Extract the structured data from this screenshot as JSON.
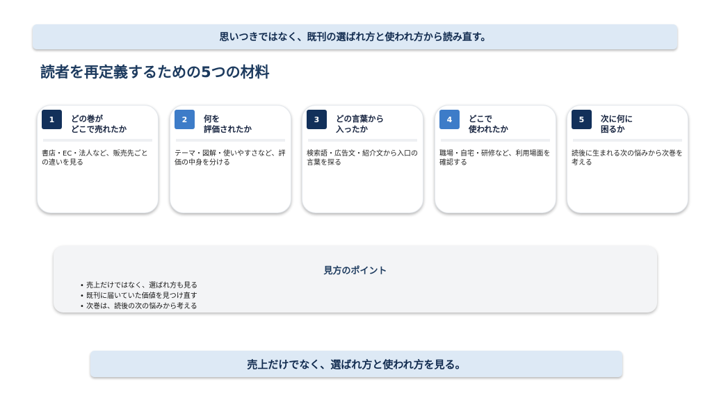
{
  "top_banner": "思いつきではなく、既刊の選ばれ方と使われ方から読み直す。",
  "title": "読者を再定義するための5つの材料",
  "cards": [
    {
      "num": "1",
      "heading": "どの巻が\nどこで売れたか",
      "body": "書店・EC・法人など、販売先ごとの違いを見る",
      "color": "#12305a"
    },
    {
      "num": "2",
      "heading": "何を\n評価されたか",
      "body": "テーマ・図解・使いやすさなど、評価の中身を分ける",
      "color": "#3d7cc8"
    },
    {
      "num": "3",
      "heading": "どの言葉から\n入ったか",
      "body": "検索語・広告文・紹介文から入口の言葉を探る",
      "color": "#12305a"
    },
    {
      "num": "4",
      "heading": "どこで\n使われたか",
      "body": "職場・自宅・研修など、利用場面を確認する",
      "color": "#3d7cc8"
    },
    {
      "num": "5",
      "heading": "次に何に\n困るか",
      "body": "読後に生まれる次の悩みから次巻を考える",
      "color": "#12305a"
    }
  ],
  "points": {
    "title": "見方のポイント",
    "items": [
      "売上だけではなく、選ばれ方も見る",
      "既刊に届いていた価値を見つけ直す",
      "次巻は、読後の次の悩みから考える"
    ]
  },
  "bottom_banner": "売上だけでなく、選ばれ方と使われ方を見る。"
}
